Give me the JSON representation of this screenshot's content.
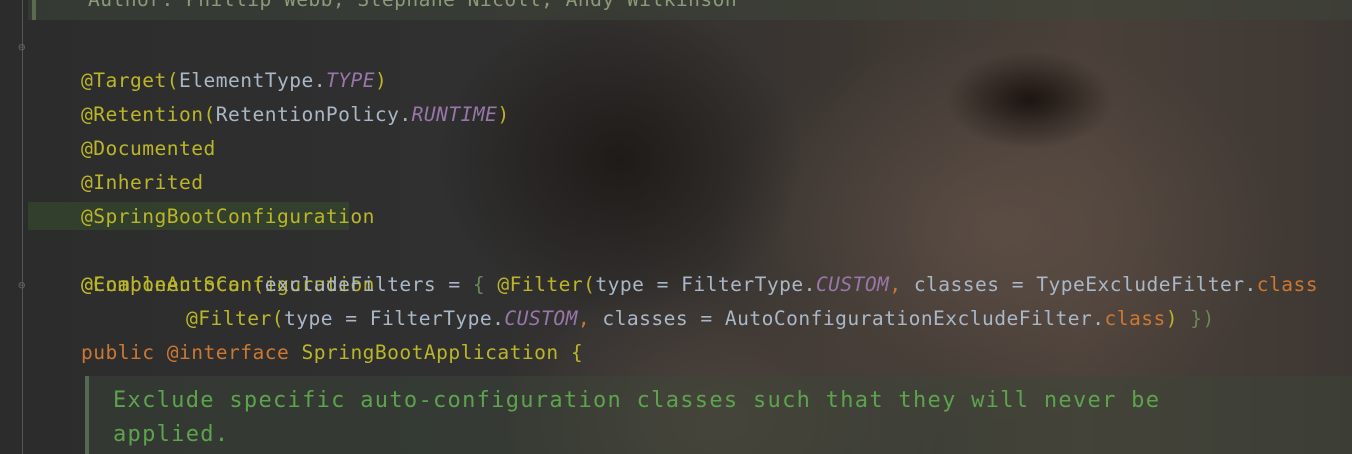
{
  "header": {
    "comment_text": "Author: Phillip Webb, Stephane Nicoll, Andy Wilkinson"
  },
  "code": {
    "line1": {
      "ann": "@Target",
      "p1": "(",
      "cls": "ElementType.",
      "const": "TYPE",
      "p2": ")"
    },
    "line2": {
      "ann": "@Retention",
      "p1": "(",
      "cls": "RetentionPolicy.",
      "const": "RUNTIME",
      "p2": ")"
    },
    "line3": {
      "ann": "@Documented"
    },
    "line4": {
      "ann": "@Inherited"
    },
    "line5": {
      "ann": "@SpringBootConfiguration"
    },
    "line6": {
      "ann": "@EnableAutoConfiguration"
    },
    "line7": {
      "ann": "@ComponentScan",
      "p1": "(",
      "t1": "excludeFilters = ",
      "brace": "{ ",
      "ann2": "@Filter",
      "p2": "(",
      "t2": "type = FilterType.",
      "const": "CUSTOM",
      "comma": ", ",
      "t3": "classes = TypeExcludeFilter.",
      "kw": "class"
    },
    "line8": {
      "ann": "@Filter",
      "p1": "(",
      "t1": "type = FilterType.",
      "const": "CUSTOM",
      "comma": ", ",
      "t2": "classes = AutoConfigurationExcludeFilter.",
      "kw": "class",
      "p2": ") ",
      "brace": "})",
      "p3": ""
    },
    "line9": {
      "kw1": "public ",
      "ann": "@interface ",
      "name": "SpringBootApplication ",
      "brace": "{"
    }
  },
  "doc": {
    "line1": "Exclude specific auto-configuration classes such that they will never be",
    "line2": "applied."
  },
  "colors": {
    "annotation": "#bbb529",
    "plain": "#a9b7c6",
    "constant": "#9876aa",
    "keyword": "#cc7832",
    "doc_comment": "#5da34e",
    "current_line": "#32432d"
  },
  "icons": {
    "fold_start": "fold-start-icon",
    "fold_end": "fold-end-icon"
  }
}
